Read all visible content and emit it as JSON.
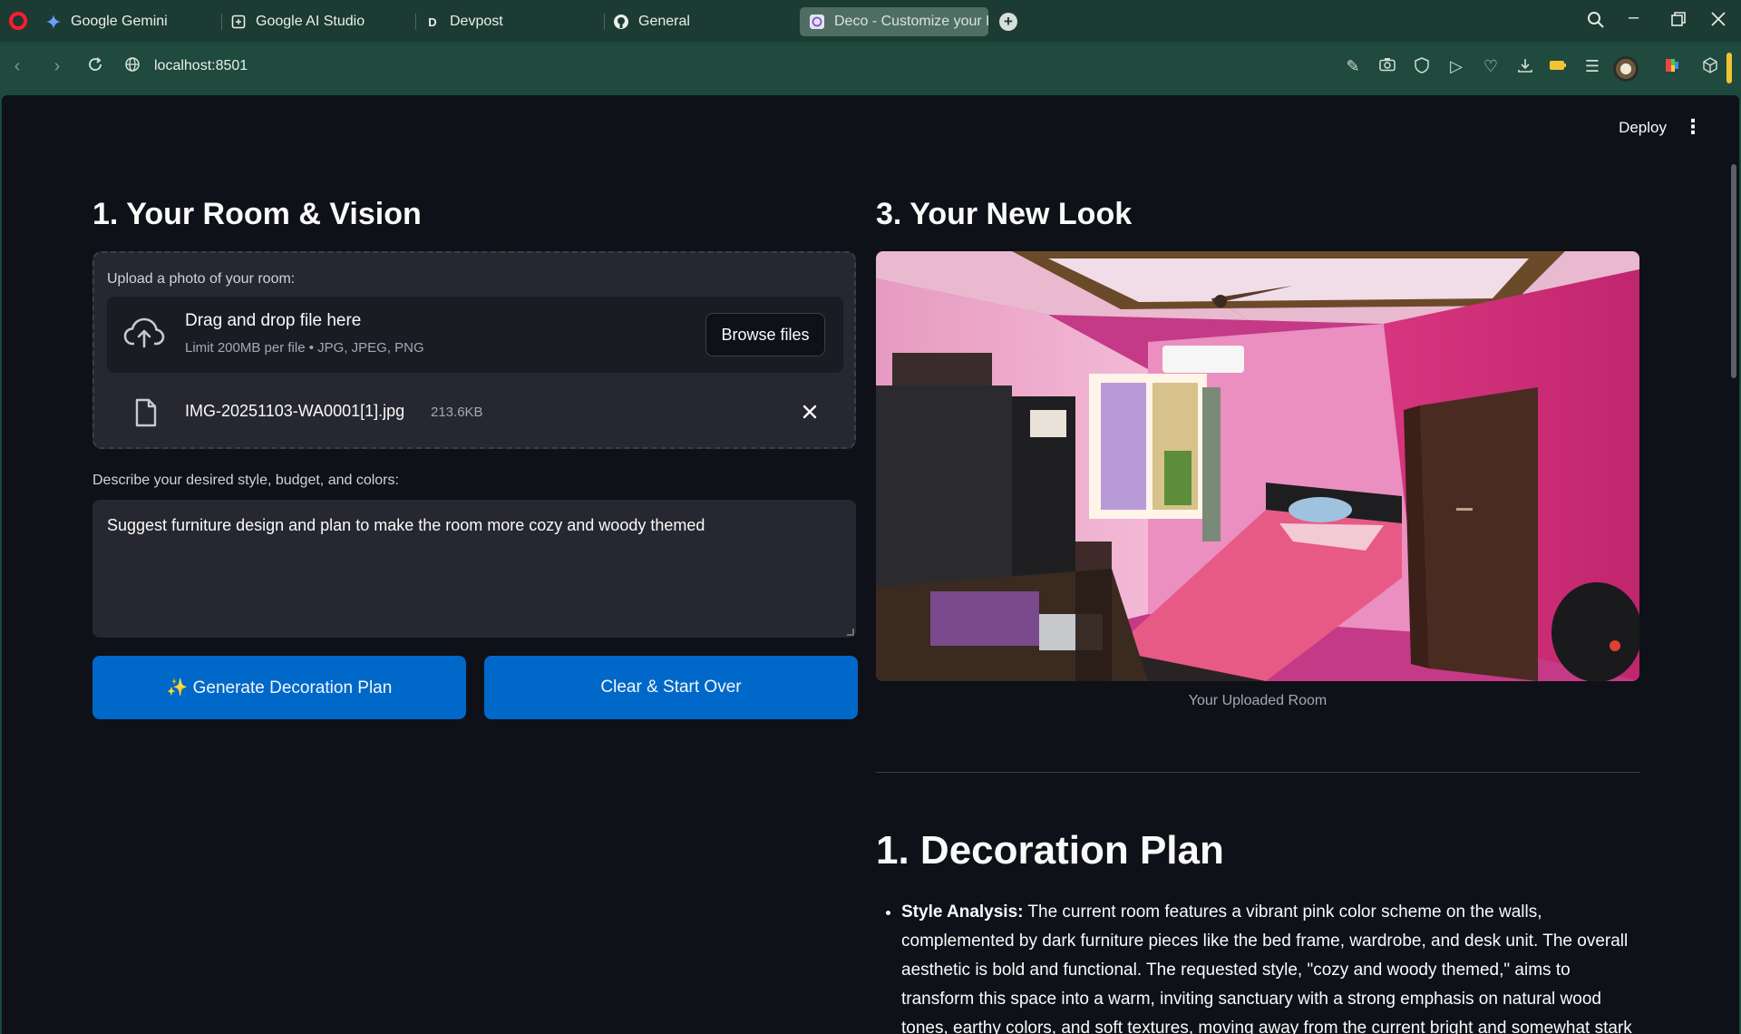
{
  "browser": {
    "tabs": [
      {
        "label": "Google Gemini",
        "icon": "gemini-icon"
      },
      {
        "label": "Google AI Studio",
        "icon": "ai-studio-icon"
      },
      {
        "label": "Devpost",
        "icon": "devpost-icon",
        "icon_glyph": "D"
      },
      {
        "label": "General",
        "icon": "github-icon"
      },
      {
        "label": "Deco - Customize your Ro",
        "icon": "app-icon",
        "active": true
      }
    ],
    "url": "localhost:8501",
    "accent": "#1c3b33"
  },
  "header": {
    "deploy_label": "Deploy"
  },
  "left": {
    "title": "1. Your Room & Vision",
    "uploader": {
      "label": "Upload a photo of your room:",
      "drop_title": "Drag and drop file here",
      "drop_sub": "Limit 200MB per file • JPG, JPEG, PNG",
      "browse_label": "Browse files",
      "file_name": "IMG-20251103-WA0001[1].jpg",
      "file_size": "213.6KB"
    },
    "description": {
      "label": "Describe your desired style, budget, and colors:",
      "value": "Suggest furniture design and plan to make the room more cozy and woody themed"
    },
    "generate_label": "✨ Generate Decoration Plan",
    "clear_label": "Clear & Start Over",
    "button_color": "#0068c9"
  },
  "right": {
    "title": "3. Your New Look",
    "image_caption": "Your Uploaded Room",
    "plan_title": "1. Decoration Plan",
    "plan_items": [
      {
        "heading": "Style Analysis:",
        "text": "The current room features a vibrant pink color scheme on the walls, complemented by dark furniture pieces like the bed frame, wardrobe, and desk unit. The overall aesthetic is bold and functional. The requested style, \"cozy and woody themed,\" aims to transform this space into a warm, inviting sanctuary with a strong emphasis on natural wood tones, earthy colors, and soft textures, moving away from the current bright and somewhat stark"
      }
    ]
  }
}
